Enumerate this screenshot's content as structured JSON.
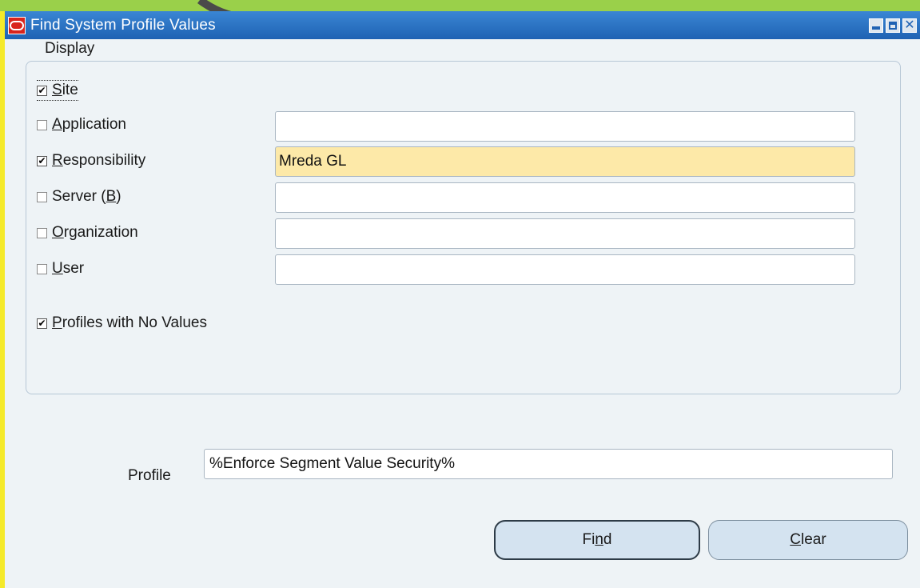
{
  "window": {
    "title": "Find System Profile Values"
  },
  "display_group": {
    "legend": "Display",
    "options": [
      {
        "label_pre": "",
        "mnemonic": "S",
        "label_post": "ite",
        "checked": true
      },
      {
        "label_pre": "",
        "mnemonic": "A",
        "label_post": "pplication",
        "checked": false,
        "value": ""
      },
      {
        "label_pre": "",
        "mnemonic": "R",
        "label_post": "esponsibility",
        "checked": true,
        "value": "Mreda GL"
      },
      {
        "label_pre": "Server (",
        "mnemonic": "B",
        "label_post": ")",
        "checked": false,
        "value": ""
      },
      {
        "label_pre": "",
        "mnemonic": "O",
        "label_post": "rganization",
        "checked": false,
        "value": ""
      },
      {
        "label_pre": "",
        "mnemonic": "U",
        "label_post": "ser",
        "checked": false,
        "value": ""
      }
    ],
    "profiles_no_values": {
      "label_pre": "",
      "mnemonic": "P",
      "label_post": "rofiles with No Values",
      "checked": true
    }
  },
  "profile": {
    "label": "Profile",
    "value": "%Enforce Segment Value Security%"
  },
  "buttons": {
    "find": {
      "pre": "Fi",
      "mnemonic": "n",
      "post": "d"
    },
    "clear": {
      "pre": "",
      "mnemonic": "C",
      "post": "lear"
    }
  },
  "colors": {
    "titlebar": "#1f62b3",
    "active_field": "#fde9a8",
    "background": "#eef3f6"
  },
  "icons": [
    "oracle-icon",
    "minimize-icon",
    "maximize-icon",
    "close-icon",
    "checkmark-icon"
  ]
}
